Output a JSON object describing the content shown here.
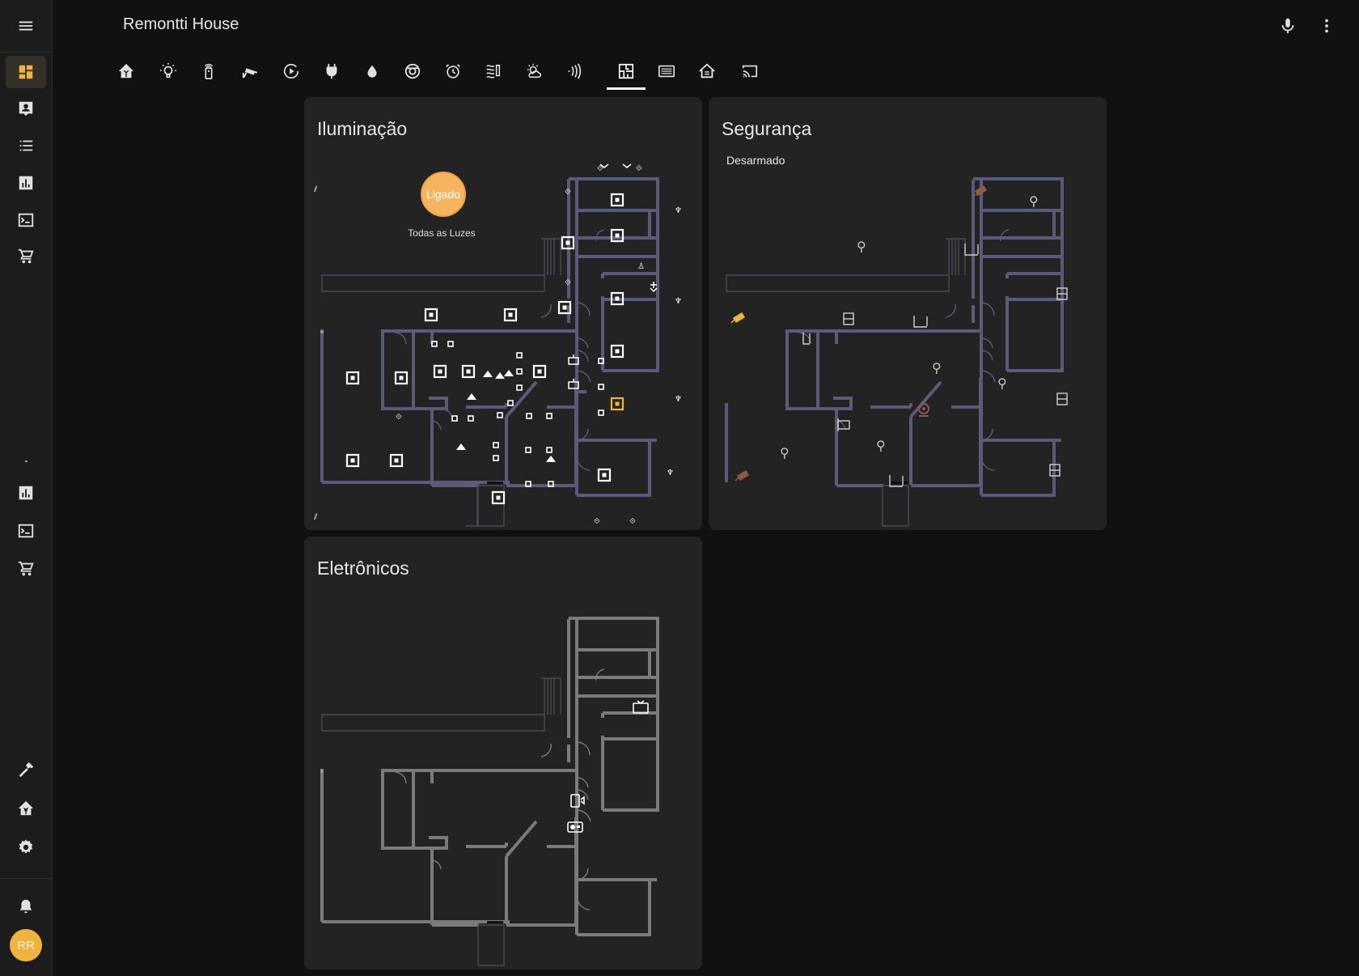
{
  "header": {
    "title": "Remontti House",
    "mic_icon": "microphone-icon",
    "more_icon": "dots-vertical-icon"
  },
  "sidebar": {
    "menu_icon": "menu-icon",
    "items": [
      {
        "icon": "view-dashboard-icon",
        "active": true
      },
      {
        "icon": "account-box-icon"
      },
      {
        "icon": "format-list-bulleted-icon"
      },
      {
        "icon": "chart-box-icon"
      },
      {
        "icon": "console-icon"
      },
      {
        "icon": "cart-icon"
      },
      {
        "icon": "chart-box-icon"
      },
      {
        "icon": "console-icon"
      },
      {
        "icon": "cart-icon"
      },
      {
        "icon": "hammer-icon"
      },
      {
        "icon": "home-assistant-icon"
      },
      {
        "icon": "cog-icon"
      },
      {
        "icon": "bell-icon"
      }
    ],
    "avatar_initials": "RR"
  },
  "tabs": [
    {
      "icon": "home-assistant-icon"
    },
    {
      "icon": "lightbulb-icon"
    },
    {
      "icon": "remote-icon"
    },
    {
      "icon": "cctv-icon"
    },
    {
      "icon": "play-circle-icon"
    },
    {
      "icon": "power-plug-icon"
    },
    {
      "icon": "water-icon"
    },
    {
      "icon": "robot-vacuum-icon"
    },
    {
      "icon": "alarm-icon"
    },
    {
      "icon": "heat-wave-icon"
    },
    {
      "icon": "weather-icon"
    },
    {
      "icon": "signal-icon"
    },
    {
      "icon": "floor-plan-icon",
      "active": true
    },
    {
      "icon": "server-icon"
    },
    {
      "icon": "home-roof-icon"
    },
    {
      "icon": "cast-icon"
    }
  ],
  "cards": {
    "lighting": {
      "title": "Iluminação",
      "all_lights_state": "Ligado",
      "all_lights_label": "Todas as Luzes"
    },
    "security": {
      "title": "Segurança",
      "alarm_state": "Desarmado"
    },
    "electronics": {
      "title": "Eletrônicos"
    }
  },
  "colors": {
    "background": "#111111",
    "card": "#232323",
    "wall": "#5b5a7c",
    "wall_grey": "#7b7b7b",
    "accent": "#f0b43e",
    "camera_off": "#8b5a4a"
  }
}
